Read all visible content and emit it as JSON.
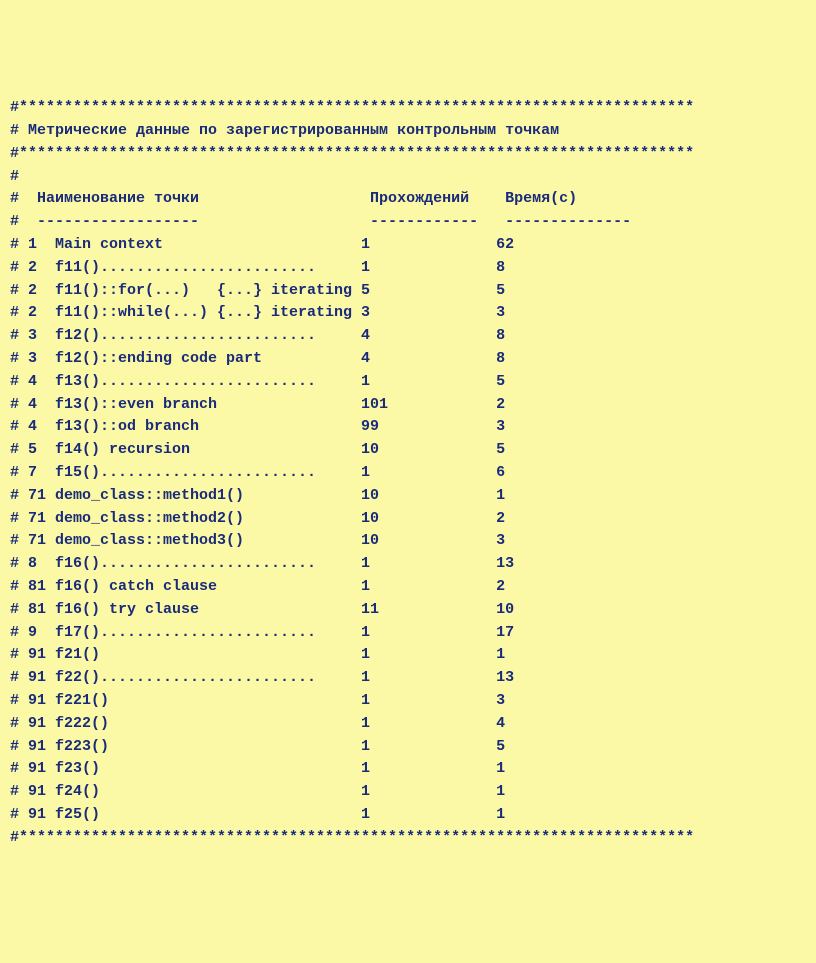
{
  "border_line": "#***************************************************************************",
  "title_line": "# Метрические данные по зарегистрированным контрольным точкам",
  "empty_line": "#",
  "header": {
    "prefix": "#  ",
    "col_name": "Наименование точки",
    "col_pass": "Прохождений",
    "col_time": "Время(с)"
  },
  "separator": {
    "prefix": "#  ",
    "col_name": "------------------",
    "col_pass": "------------",
    "col_time": "--------------"
  },
  "rows": [
    {
      "id": "1",
      "name": "Main context",
      "pass": "1",
      "time": "62"
    },
    {
      "id": "2",
      "name": "f11()........................",
      "pass": "1",
      "time": "8"
    },
    {
      "id": "2",
      "name": "f11()::for(...)   {...} iterating",
      "pass": "5",
      "time": "5"
    },
    {
      "id": "2",
      "name": "f11()::while(...) {...} iterating",
      "pass": "3",
      "time": "3"
    },
    {
      "id": "3",
      "name": "f12()........................",
      "pass": "4",
      "time": "8"
    },
    {
      "id": "3",
      "name": "f12()::ending code part",
      "pass": "4",
      "time": "8"
    },
    {
      "id": "4",
      "name": "f13()........................",
      "pass": "1",
      "time": "5"
    },
    {
      "id": "4",
      "name": "f13()::even branch",
      "pass": "101",
      "time": "2"
    },
    {
      "id": "4",
      "name": "f13()::od branch",
      "pass": "99",
      "time": "3"
    },
    {
      "id": "5",
      "name": "f14() recursion",
      "pass": "10",
      "time": "5"
    },
    {
      "id": "7",
      "name": "f15()........................",
      "pass": "1",
      "time": "6"
    },
    {
      "id": "71",
      "name": "demo_class::method1()",
      "pass": "10",
      "time": "1"
    },
    {
      "id": "71",
      "name": "demo_class::method2()",
      "pass": "10",
      "time": "2"
    },
    {
      "id": "71",
      "name": "demo_class::method3()",
      "pass": "10",
      "time": "3"
    },
    {
      "id": "8",
      "name": "f16()........................",
      "pass": "1",
      "time": "13"
    },
    {
      "id": "81",
      "name": "f16() catch clause",
      "pass": "1",
      "time": "2"
    },
    {
      "id": "81",
      "name": "f16() try clause",
      "pass": "11",
      "time": "10"
    },
    {
      "id": "9",
      "name": "f17()........................",
      "pass": "1",
      "time": "17"
    },
    {
      "id": "91",
      "name": "f21()",
      "pass": "1",
      "time": "1"
    },
    {
      "id": "91",
      "name": "f22()........................",
      "pass": "1",
      "time": "13"
    },
    {
      "id": "91",
      "name": "f221()",
      "pass": "1",
      "time": "3"
    },
    {
      "id": "91",
      "name": "f222()",
      "pass": "1",
      "time": "4"
    },
    {
      "id": "91",
      "name": "f223()",
      "pass": "1",
      "time": "5"
    },
    {
      "id": "91",
      "name": "f23()",
      "pass": "1",
      "time": "1"
    },
    {
      "id": "91",
      "name": "f24()",
      "pass": "1",
      "time": "1"
    },
    {
      "id": "91",
      "name": "f25()",
      "pass": "1",
      "time": "1"
    }
  ],
  "columns": {
    "id_width": 3,
    "name_width": 34,
    "pass_width": 15
  }
}
